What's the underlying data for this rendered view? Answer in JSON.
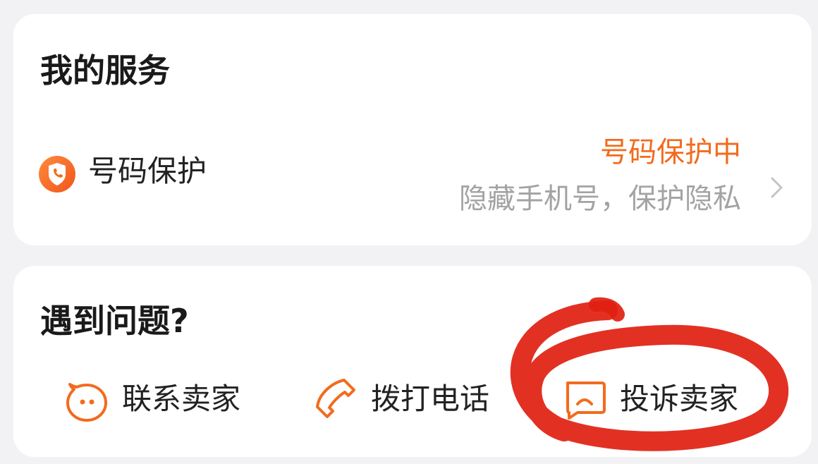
{
  "services": {
    "title": "我的服务",
    "number_protection": {
      "label": "号码保护",
      "status": "号码保护中",
      "description": "隐藏手机号，保护隐私",
      "icon": "shield-phone-icon",
      "chevron_icon": "chevron-right-icon"
    }
  },
  "problems": {
    "title": "遇到问题?",
    "actions": [
      {
        "label": "联系卖家",
        "icon": "chat-face-icon"
      },
      {
        "label": "拨打电话",
        "icon": "phone-icon"
      },
      {
        "label": "投诉卖家",
        "icon": "complaint-icon"
      }
    ]
  },
  "colors": {
    "accent": "#f26b1d",
    "muted_text": "#a3a3a3",
    "annotation": "#e02010",
    "background": "#f2f2f4",
    "card": "#ffffff"
  }
}
